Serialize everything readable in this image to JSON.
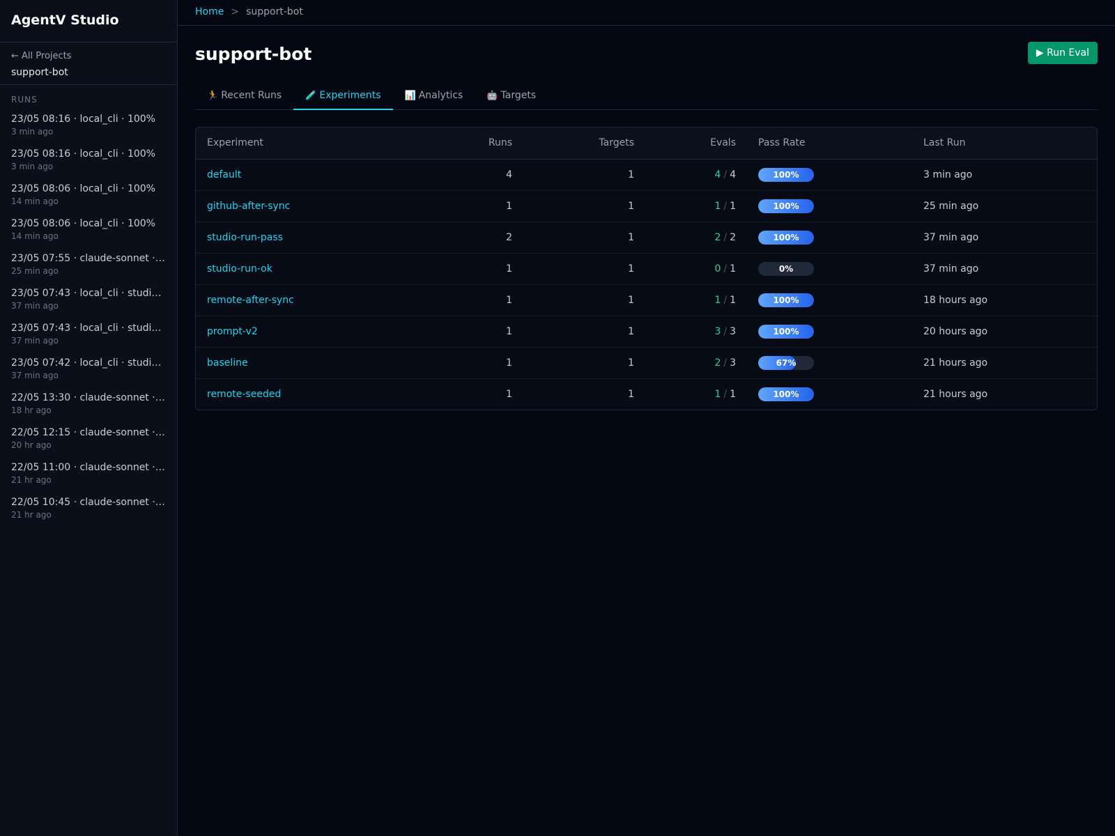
{
  "sidebar": {
    "brand": "AgentV Studio",
    "back_label": "← All Projects",
    "project_name": "support-bot",
    "runs_heading": "RUNS",
    "runs": [
      {
        "title": "23/05 08:16 · local_cli · 100%",
        "time": "3 min ago"
      },
      {
        "title": "23/05 08:16 · local_cli · 100%",
        "time": "3 min ago"
      },
      {
        "title": "23/05 08:06 · local_cli · 100%",
        "time": "14 min ago"
      },
      {
        "title": "23/05 08:06 · local_cli · 100%",
        "time": "14 min ago"
      },
      {
        "title": "23/05 07:55 · claude-sonnet ·…",
        "time": "25 min ago"
      },
      {
        "title": "23/05 07:43 · local_cli · studi…",
        "time": "37 min ago"
      },
      {
        "title": "23/05 07:43 · local_cli · studi…",
        "time": "37 min ago"
      },
      {
        "title": "23/05 07:42 · local_cli · studi…",
        "time": "37 min ago"
      },
      {
        "title": "22/05 13:30 · claude-sonnet ·…",
        "time": "18 hr ago"
      },
      {
        "title": "22/05 12:15 · claude-sonnet ·…",
        "time": "20 hr ago"
      },
      {
        "title": "22/05 11:00 · claude-sonnet ·…",
        "time": "21 hr ago"
      },
      {
        "title": "22/05 10:45 · claude-sonnet ·…",
        "time": "21 hr ago"
      }
    ]
  },
  "breadcrumb": {
    "home": "Home",
    "separator": ">",
    "current": "support-bot"
  },
  "page": {
    "title": "support-bot",
    "run_eval_label": "▶ Run Eval"
  },
  "tabs": [
    {
      "icon": "🏃",
      "icon_name": "running-icon",
      "label": "Recent Runs",
      "active": false
    },
    {
      "icon": "🧪",
      "icon_name": "test-tube-icon",
      "label": "Experiments",
      "active": true
    },
    {
      "icon": "📊",
      "icon_name": "bar-chart-icon",
      "label": "Analytics",
      "active": false
    },
    {
      "icon": "🤖",
      "icon_name": "robot-icon",
      "label": "Targets",
      "active": false
    }
  ],
  "table": {
    "headers": {
      "experiment": "Experiment",
      "runs": "Runs",
      "targets": "Targets",
      "evals": "Evals",
      "pass_rate": "Pass Rate",
      "last_run": "Last Run"
    },
    "rows": [
      {
        "experiment": "default",
        "runs": "4",
        "targets": "1",
        "evals_passed": "4",
        "evals_total": "4",
        "pass_rate": "100%",
        "pass_fraction": 1.0,
        "last_run": "3 min ago"
      },
      {
        "experiment": "github-after-sync",
        "runs": "1",
        "targets": "1",
        "evals_passed": "1",
        "evals_total": "1",
        "pass_rate": "100%",
        "pass_fraction": 1.0,
        "last_run": "25 min ago"
      },
      {
        "experiment": "studio-run-pass",
        "runs": "2",
        "targets": "1",
        "evals_passed": "2",
        "evals_total": "2",
        "pass_rate": "100%",
        "pass_fraction": 1.0,
        "last_run": "37 min ago"
      },
      {
        "experiment": "studio-run-ok",
        "runs": "1",
        "targets": "1",
        "evals_passed": "0",
        "evals_total": "1",
        "pass_rate": "0%",
        "pass_fraction": 0.0,
        "last_run": "37 min ago"
      },
      {
        "experiment": "remote-after-sync",
        "runs": "1",
        "targets": "1",
        "evals_passed": "1",
        "evals_total": "1",
        "pass_rate": "100%",
        "pass_fraction": 1.0,
        "last_run": "18 hours ago"
      },
      {
        "experiment": "prompt-v2",
        "runs": "1",
        "targets": "1",
        "evals_passed": "3",
        "evals_total": "3",
        "pass_rate": "100%",
        "pass_fraction": 1.0,
        "last_run": "20 hours ago"
      },
      {
        "experiment": "baseline",
        "runs": "1",
        "targets": "1",
        "evals_passed": "2",
        "evals_total": "3",
        "pass_rate": "67%",
        "pass_fraction": 0.67,
        "last_run": "21 hours ago"
      },
      {
        "experiment": "remote-seeded",
        "runs": "1",
        "targets": "1",
        "evals_passed": "1",
        "evals_total": "1",
        "pass_rate": "100%",
        "pass_fraction": 1.0,
        "last_run": "21 hours ago"
      }
    ]
  },
  "colors": {
    "accent": "#22d3ee",
    "pass": "#34d399",
    "run_button": "#059669",
    "bar_fill": "#3b82f6"
  }
}
